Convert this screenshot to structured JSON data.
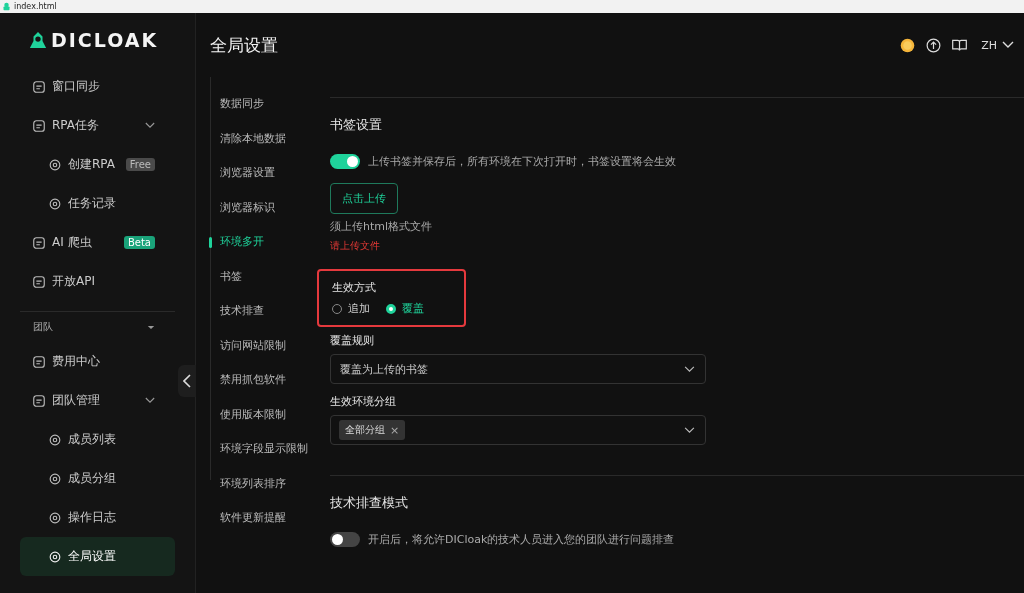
{
  "browser_tab": {
    "title": "index.html"
  },
  "logo": {
    "text": "DICLOAK"
  },
  "sidebar": {
    "sections": [
      {
        "items": [
          {
            "label": "窗口同步",
            "selected": false
          },
          {
            "label": "RPA任务",
            "selected": false,
            "expanded": true,
            "children": [
              {
                "label": "创建RPA",
                "selected": false,
                "badge": {
                  "text": "Free",
                  "kind": "muted"
                }
              },
              {
                "label": "任务记录",
                "selected": false
              }
            ]
          },
          {
            "label": "AI 爬虫",
            "selected": false,
            "badge": {
              "text": "Beta",
              "kind": "accent"
            }
          },
          {
            "label": "开放API",
            "selected": false
          }
        ]
      },
      {
        "title": "团队",
        "expanded": true,
        "items": [
          {
            "label": "费用中心",
            "selected": false
          },
          {
            "label": "团队管理",
            "selected": false,
            "expanded": true,
            "children": [
              {
                "label": "成员列表",
                "selected": false
              },
              {
                "label": "成员分组",
                "selected": false
              },
              {
                "label": "操作日志",
                "selected": false
              },
              {
                "label": "全局设置",
                "selected": true
              }
            ]
          }
        ]
      }
    ]
  },
  "header": {
    "title": "全局设置",
    "language": "ZH"
  },
  "settings_nav": [
    {
      "label": "数据同步",
      "selected": false
    },
    {
      "label": "清除本地数据",
      "selected": false
    },
    {
      "label": "浏览器设置",
      "selected": false
    },
    {
      "label": "浏览器标识",
      "selected": false
    },
    {
      "label": "环境多开",
      "selected": true
    },
    {
      "label": "书签",
      "selected": false
    },
    {
      "label": "技术排查",
      "selected": false
    },
    {
      "label": "访问网站限制",
      "selected": false
    },
    {
      "label": "禁用抓包软件",
      "selected": false
    },
    {
      "label": "使用版本限制",
      "selected": false
    },
    {
      "label": "环境字段显示限制",
      "selected": false
    },
    {
      "label": "环境列表排序",
      "selected": false
    },
    {
      "label": "软件更新提醒",
      "selected": false
    }
  ],
  "bookmark_settings": {
    "title": "书签设置",
    "toggle": {
      "on": true,
      "text": "上传书签并保存后，所有环境在下次打开时，书签设置将会生效"
    },
    "upload_button": "点击上传",
    "hint": "须上传html格式文件",
    "error": "请上传文件",
    "apply_mode": {
      "label": "生效方式",
      "highlighted": true,
      "options": [
        {
          "label": "追加",
          "selected": false
        },
        {
          "label": "覆盖",
          "selected": true
        }
      ]
    },
    "override_rule": {
      "label": "覆盖规则",
      "value": "覆盖为上传的书签"
    },
    "env_groups": {
      "label": "生效环境分组",
      "tags": [
        {
          "label": "全部分组",
          "remove": "×"
        }
      ]
    }
  },
  "tech_support": {
    "title": "技术排查模式",
    "toggle": {
      "on": false,
      "text": "开启后，将允许DICloak的技术人员进入您的团队进行问题排查"
    }
  }
}
